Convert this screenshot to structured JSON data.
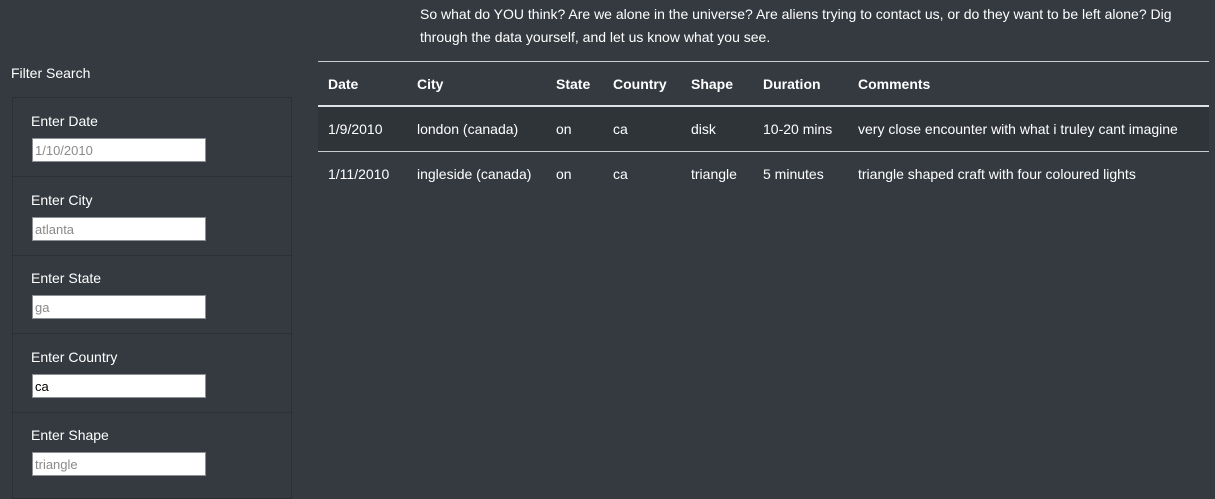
{
  "intro": {
    "text": "So what do YOU think? Are we alone in the universe? Are aliens trying to contact us, or do they want to be left alone? Dig through the data yourself, and let us know what you see."
  },
  "filters": {
    "title": "Filter Search",
    "items": [
      {
        "label": "Enter Date",
        "value": "",
        "placeholder": "1/10/2010"
      },
      {
        "label": "Enter City",
        "value": "",
        "placeholder": "atlanta"
      },
      {
        "label": "Enter State",
        "value": "",
        "placeholder": "ga"
      },
      {
        "label": "Enter Country",
        "value": "ca",
        "placeholder": ""
      },
      {
        "label": "Enter Shape",
        "value": "",
        "placeholder": "triangle"
      }
    ]
  },
  "table": {
    "headers": [
      "Date",
      "City",
      "State",
      "Country",
      "Shape",
      "Duration",
      "Comments"
    ],
    "rows": [
      [
        "1/9/2010",
        "london (canada)",
        "on",
        "ca",
        "disk",
        "10-20 mins",
        "very close encounter with what i truley cant imagine"
      ],
      [
        "1/11/2010",
        "ingleside (canada)",
        "on",
        "ca",
        "triangle",
        "5 minutes",
        "triangle shaped craft with four coloured lights"
      ]
    ]
  },
  "colors": {
    "background": "#343a40",
    "text": "#ffffff",
    "row_stripe": "#2f3439"
  }
}
